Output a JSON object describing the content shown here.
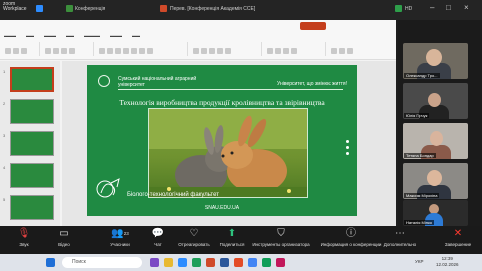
{
  "zoom": {
    "brand_line1": "zoom",
    "brand_line2": "Workplace",
    "conference_label": "Конференція",
    "window_title": "Перев. [Конференція Академія ССЕ]",
    "quality_label": "HD"
  },
  "ppt": {
    "thumb_numbers": [
      "1",
      "2",
      "3",
      "4",
      "5"
    ]
  },
  "slide": {
    "university": "Сумський національний аграрний університет",
    "motto": "Університет, що змінює життя!",
    "heading": "Технологія виробництва продукції кролівництва та звірівництва",
    "faculty": "Біолого-технологічний факультет",
    "site": "SNAU.EDU.UA"
  },
  "participants": [
    {
      "name": "Олександр Тро..."
    },
    {
      "name": "Юлія Гірчук"
    },
    {
      "name": "Тетяна Бондар"
    },
    {
      "name": "Максим Мірохіна"
    },
    {
      "name": "Наталія Мінко"
    }
  ],
  "toolbar": {
    "audio": "Звук",
    "video": "Відео",
    "participants": "Учасники",
    "participants_count": "23",
    "chat": "Чат",
    "react": "Отреагировать",
    "share": "Поделиться",
    "tools": "Инструменты организатора",
    "info": "Информация о конференции",
    "more": "Дополнительно",
    "end": "Завершение"
  },
  "taskbar": {
    "search_placeholder": "Поиск",
    "lang": "УКР",
    "time": "12:39",
    "date": "12.02.2026"
  },
  "colors": {
    "slide_green": "#1f8a43",
    "ppt_accent": "#c43e1c",
    "end_red": "#ff3b30"
  }
}
